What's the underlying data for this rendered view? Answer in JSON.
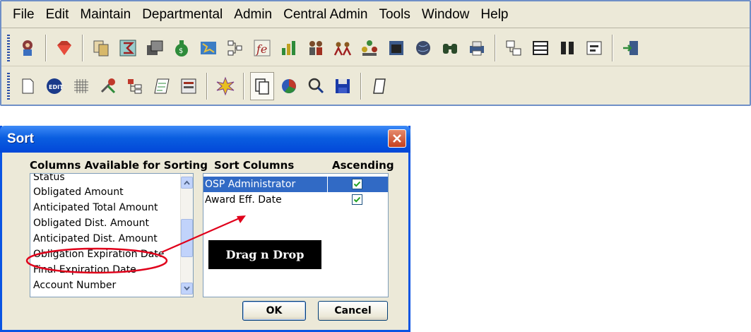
{
  "menubar": {
    "items": [
      "File",
      "Edit",
      "Maintain",
      "Departmental",
      "Admin",
      "Central Admin",
      "Tools",
      "Window",
      "Help"
    ]
  },
  "dialog": {
    "title": "Sort",
    "available_header": "Columns Available for Sorting",
    "sort_header": "Sort Columns",
    "ascending_header": "Ascending",
    "available_columns": [
      "Status",
      "Obligated Amount",
      "Anticipated Total Amount",
      "Obligated Dist. Amount",
      "Anticipated Dist. Amount",
      "Obligation Expiration Date",
      "Final Expiration Date",
      "Account Number"
    ],
    "sort_columns": [
      {
        "name": "OSP Administrator",
        "ascending": true,
        "selected": true
      },
      {
        "name": "Award Eff. Date",
        "ascending": true,
        "selected": false
      }
    ],
    "ok_label": "OK",
    "cancel_label": "Cancel",
    "annotation_label": "Drag n Drop"
  },
  "colors": {
    "selection": "#316ac5",
    "annotation_red": "#e0001b",
    "titlebar": "#0a5ee0"
  }
}
